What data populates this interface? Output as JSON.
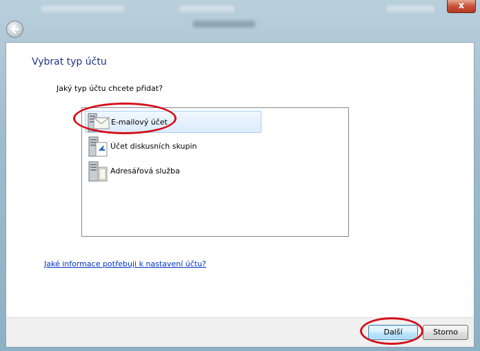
{
  "window": {
    "close_label": "x"
  },
  "header": {
    "title": "Vybrat typ účtu",
    "question": "Jaký typ účtu chcete přidat?"
  },
  "account_types": [
    {
      "label": "E-mailový účet",
      "icon": "mail-account-icon",
      "selected": true
    },
    {
      "label": "Účet diskusních skupin",
      "icon": "newsgroup-account-icon",
      "selected": false
    },
    {
      "label": "Adresářová služba",
      "icon": "directory-service-icon",
      "selected": false
    }
  ],
  "help_link": "Jaké informace potřebuji k nastavení účtu?",
  "buttons": {
    "next": "Další",
    "cancel": "Storno"
  },
  "colors": {
    "title": "#1e3287",
    "link": "#0033cc",
    "selection": "#dcebfc",
    "annotation_ring": "#d4101a"
  }
}
